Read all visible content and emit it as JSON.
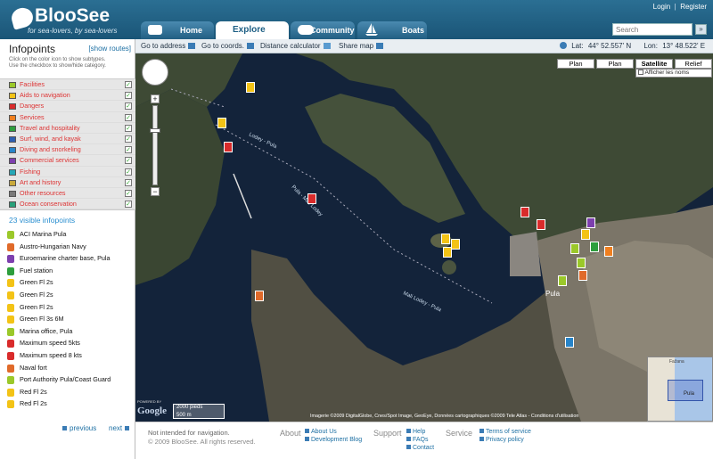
{
  "header": {
    "logo_text": "BlooSee",
    "tagline": "for sea-lovers, by sea-lovers",
    "login": "Login",
    "separator": "|",
    "register": "Register",
    "tabs": [
      {
        "label": "Home",
        "icon": "home-icon"
      },
      {
        "label": "Explore",
        "icon": ""
      },
      {
        "label": "Community",
        "icon": "people-icon"
      },
      {
        "label": "Boats",
        "icon": "sailboat-icon"
      }
    ],
    "search_placeholder": "Search",
    "search_button": "»"
  },
  "toolbar": {
    "go_to_address": "Go to address",
    "go_to_coords": "Go to coords.",
    "distance_calculator": "Distance calculator",
    "share_map": "Share map",
    "lat_label": "Lat:",
    "lat_value": "44° 52.557' N",
    "lon_label": "Lon:",
    "lon_value": "13° 48.522' E"
  },
  "sidebar": {
    "title": "Infopoints",
    "show_routes": "[show routes]",
    "help_line1": "Click on the color icon to show subtypes.",
    "help_line2": "Use the checkbox to show/hide category.",
    "categories": [
      {
        "label": "Facilities",
        "color": "#9bc82a",
        "checked": true
      },
      {
        "label": "Aids to navigation",
        "color": "#f3c316",
        "checked": true
      },
      {
        "label": "Dangers",
        "color": "#d92b2b",
        "checked": true
      },
      {
        "label": "Services",
        "color": "#f07f1f",
        "checked": true
      },
      {
        "label": "Travel and hospitality",
        "color": "#2e9e3d",
        "checked": true
      },
      {
        "label": "Surf, wind, and kayak",
        "color": "#2c5fb2",
        "checked": true
      },
      {
        "label": "Diving and snorkeling",
        "color": "#2784c9",
        "checked": true
      },
      {
        "label": "Commercial services",
        "color": "#7d3fae",
        "checked": true
      },
      {
        "label": "Fishing",
        "color": "#24a7b7",
        "checked": true
      },
      {
        "label": "Art and history",
        "color": "#c9a93b",
        "checked": true
      },
      {
        "label": "Other resources",
        "color": "#7a7a7a",
        "checked": true
      },
      {
        "label": "Ocean conservation",
        "color": "#27a07a",
        "checked": true
      }
    ],
    "visible_infopoints": "23 visible infopoints",
    "infopoints": [
      {
        "label": "ACI Marina Pula",
        "color": "#9bc82a"
      },
      {
        "label": "Austro-Hungarian Navy",
        "color": "#e06a2a"
      },
      {
        "label": "Euroemarine charter base, Pula",
        "color": "#7d3fae"
      },
      {
        "label": "Fuel station",
        "color": "#2e9e3d"
      },
      {
        "label": "Green Fl 2s",
        "color": "#f3c316"
      },
      {
        "label": "Green Fl 2s",
        "color": "#f3c316"
      },
      {
        "label": "Green Fl 2s",
        "color": "#f3c316"
      },
      {
        "label": "Green Fl 3s 6M",
        "color": "#f3c316"
      },
      {
        "label": "Marina office, Pula",
        "color": "#9bc82a"
      },
      {
        "label": "Maximum speed 5kts",
        "color": "#d92b2b"
      },
      {
        "label": "Maximum speed 8 kts",
        "color": "#d92b2b"
      },
      {
        "label": "Naval fort",
        "color": "#e06a2a"
      },
      {
        "label": "Port Authority Pula/Coast Guard",
        "color": "#9bc82a"
      },
      {
        "label": "Red Fl 2s",
        "color": "#f3c316"
      },
      {
        "label": "Red Fl 2s",
        "color": "#f3c316"
      }
    ],
    "previous": "previous",
    "next": "next"
  },
  "map": {
    "types": [
      "Plan",
      "Plan",
      "Satellite",
      "Relief"
    ],
    "selected_type": "Satellite",
    "show_names": "Afficher les noms",
    "scale_feet": "2000 pieds",
    "scale_m": "500 m",
    "google": "Google",
    "powered_by": "POWERED BY",
    "attribution": "Imagerie ©2009 DigitalGlobe, Cnes/Spot Image, GeoEye, Données cartographiques ©2009 Tele Atlas - Conditions d'utilisation",
    "labels": {
      "pula": "Pula",
      "lodey": "Lodey - Pula",
      "mali": "Mali Lodey - Pula",
      "pula_sea": "Pula - Mali Lodey",
      "fazana": "Fažana",
      "pula_inset": "Pula"
    }
  },
  "footer": {
    "note1": "Not intended for navigation.",
    "note2": "© 2009 BlooSee. All rights reserved.",
    "about": "About",
    "about_links": [
      "About Us",
      "Development Blog"
    ],
    "support": "Support",
    "support_links": [
      "Help",
      "FAQs",
      "Contact"
    ],
    "service": "Service",
    "service_links": [
      "Terms of service",
      "Privacy policy"
    ]
  }
}
